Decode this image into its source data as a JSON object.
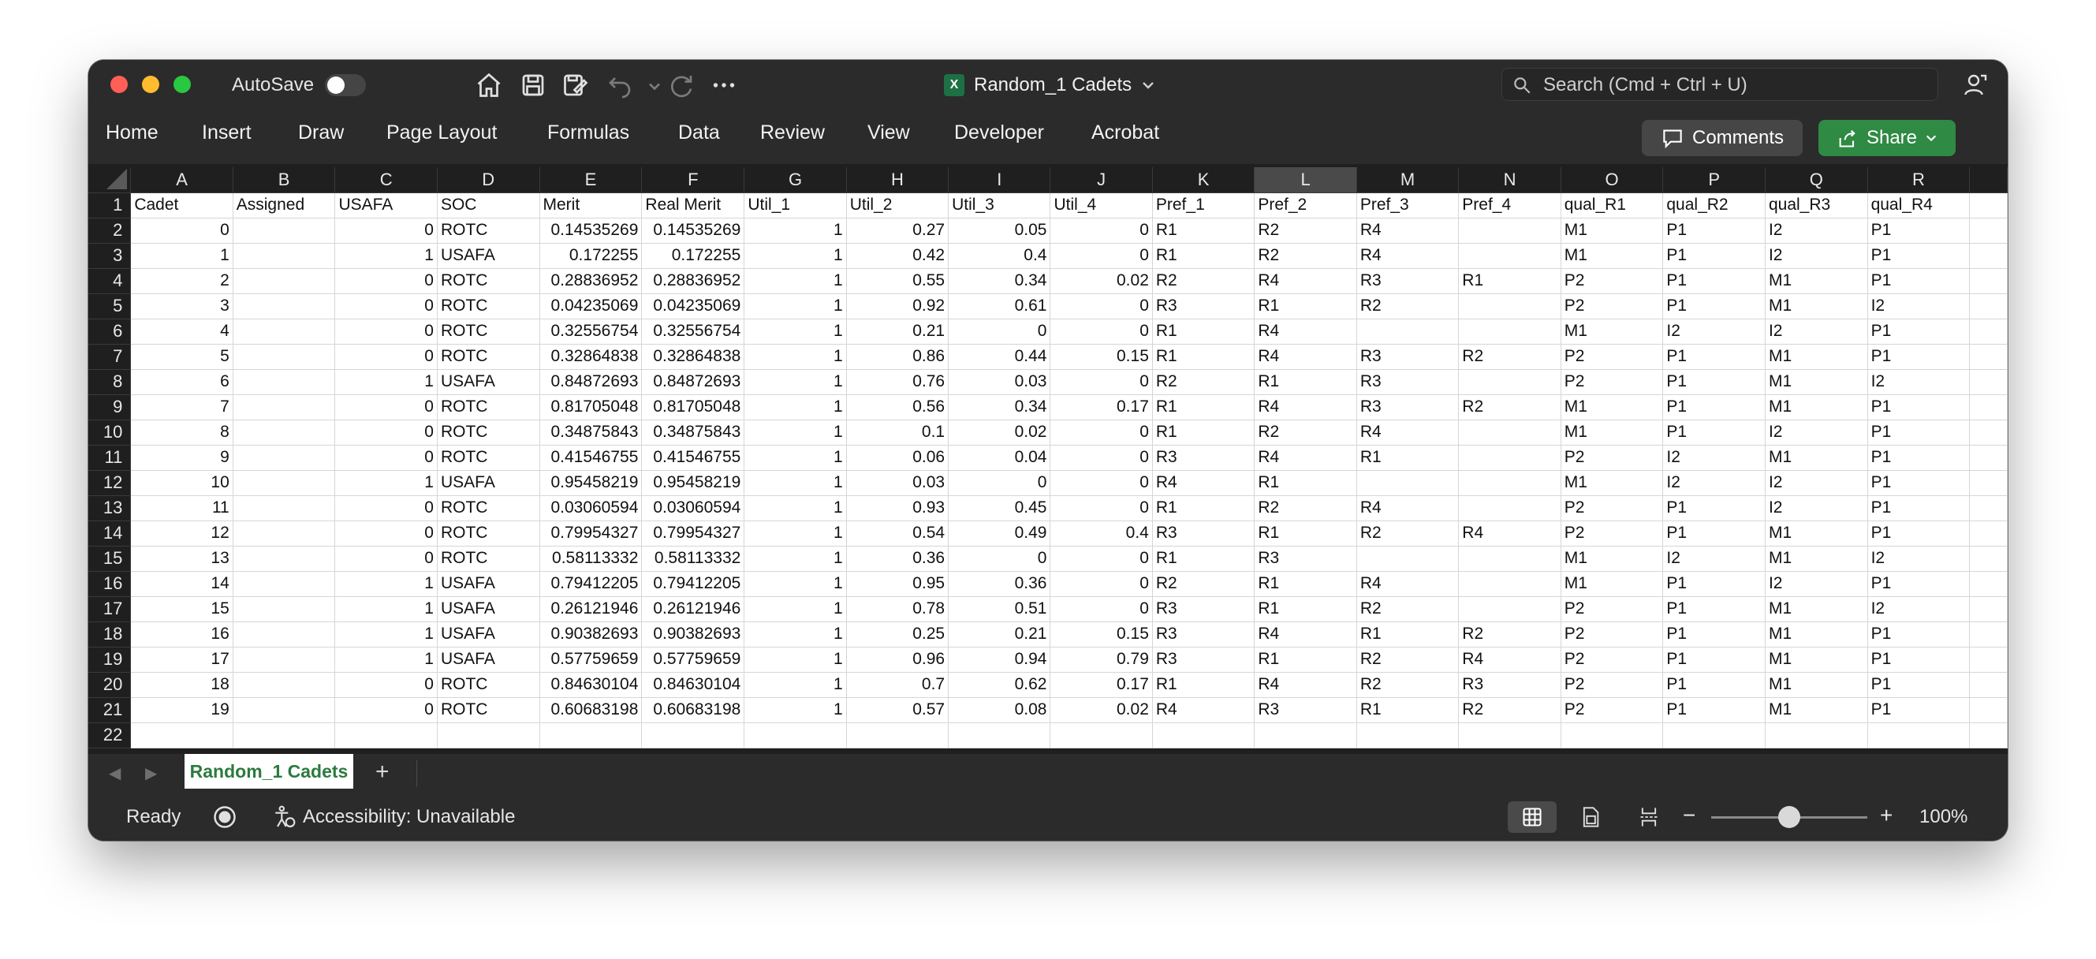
{
  "window": {
    "autosave_label": "AutoSave",
    "title": "Random_1 Cadets",
    "search_placeholder": "Search (Cmd + Ctrl + U)"
  },
  "ribbon": {
    "tabs": [
      "Home",
      "Insert",
      "Draw",
      "Page Layout",
      "Formulas",
      "Data",
      "Review",
      "View",
      "Developer",
      "Acrobat"
    ],
    "comments_label": "Comments",
    "share_label": "Share"
  },
  "sheet": {
    "columns": [
      "A",
      "B",
      "C",
      "D",
      "E",
      "F",
      "G",
      "H",
      "I",
      "J",
      "K",
      "L",
      "M",
      "N",
      "O",
      "P",
      "Q",
      "R"
    ],
    "selected_column": "L",
    "header": [
      "Cadet",
      "Assigned",
      "USAFA",
      "SOC",
      "Merit",
      "Real Merit",
      "Util_1",
      "Util_2",
      "Util_3",
      "Util_4",
      "Pref_1",
      "Pref_2",
      "Pref_3",
      "Pref_4",
      "qual_R1",
      "qual_R2",
      "qual_R3",
      "qual_R4"
    ],
    "rows": [
      [
        "0",
        "",
        "0",
        "ROTC",
        "0.14535269",
        "0.14535269",
        "1",
        "0.27",
        "0.05",
        "0",
        "R1",
        "R2",
        "R4",
        "",
        "M1",
        "P1",
        "I2",
        "P1"
      ],
      [
        "1",
        "",
        "1",
        "USAFA",
        "0.172255",
        "0.172255",
        "1",
        "0.42",
        "0.4",
        "0",
        "R1",
        "R2",
        "R4",
        "",
        "M1",
        "P1",
        "I2",
        "P1"
      ],
      [
        "2",
        "",
        "0",
        "ROTC",
        "0.28836952",
        "0.28836952",
        "1",
        "0.55",
        "0.34",
        "0.02",
        "R2",
        "R4",
        "R3",
        "R1",
        "P2",
        "P1",
        "M1",
        "P1"
      ],
      [
        "3",
        "",
        "0",
        "ROTC",
        "0.04235069",
        "0.04235069",
        "1",
        "0.92",
        "0.61",
        "0",
        "R3",
        "R1",
        "R2",
        "",
        "P2",
        "P1",
        "M1",
        "I2"
      ],
      [
        "4",
        "",
        "0",
        "ROTC",
        "0.32556754",
        "0.32556754",
        "1",
        "0.21",
        "0",
        "0",
        "R1",
        "R4",
        "",
        "",
        "M1",
        "I2",
        "I2",
        "P1"
      ],
      [
        "5",
        "",
        "0",
        "ROTC",
        "0.32864838",
        "0.32864838",
        "1",
        "0.86",
        "0.44",
        "0.15",
        "R1",
        "R4",
        "R3",
        "R2",
        "P2",
        "P1",
        "M1",
        "P1"
      ],
      [
        "6",
        "",
        "1",
        "USAFA",
        "0.84872693",
        "0.84872693",
        "1",
        "0.76",
        "0.03",
        "0",
        "R2",
        "R1",
        "R3",
        "",
        "P2",
        "P1",
        "M1",
        "I2"
      ],
      [
        "7",
        "",
        "0",
        "ROTC",
        "0.81705048",
        "0.81705048",
        "1",
        "0.56",
        "0.34",
        "0.17",
        "R1",
        "R4",
        "R3",
        "R2",
        "M1",
        "P1",
        "M1",
        "P1"
      ],
      [
        "8",
        "",
        "0",
        "ROTC",
        "0.34875843",
        "0.34875843",
        "1",
        "0.1",
        "0.02",
        "0",
        "R1",
        "R2",
        "R4",
        "",
        "M1",
        "P1",
        "I2",
        "P1"
      ],
      [
        "9",
        "",
        "0",
        "ROTC",
        "0.41546755",
        "0.41546755",
        "1",
        "0.06",
        "0.04",
        "0",
        "R3",
        "R4",
        "R1",
        "",
        "P2",
        "I2",
        "M1",
        "P1"
      ],
      [
        "10",
        "",
        "1",
        "USAFA",
        "0.95458219",
        "0.95458219",
        "1",
        "0.03",
        "0",
        "0",
        "R4",
        "R1",
        "",
        "",
        "M1",
        "I2",
        "I2",
        "P1"
      ],
      [
        "11",
        "",
        "0",
        "ROTC",
        "0.03060594",
        "0.03060594",
        "1",
        "0.93",
        "0.45",
        "0",
        "R1",
        "R2",
        "R4",
        "",
        "P2",
        "P1",
        "I2",
        "P1"
      ],
      [
        "12",
        "",
        "0",
        "ROTC",
        "0.79954327",
        "0.79954327",
        "1",
        "0.54",
        "0.49",
        "0.4",
        "R3",
        "R1",
        "R2",
        "R4",
        "P2",
        "P1",
        "M1",
        "P1"
      ],
      [
        "13",
        "",
        "0",
        "ROTC",
        "0.58113332",
        "0.58113332",
        "1",
        "0.36",
        "0",
        "0",
        "R1",
        "R3",
        "",
        "",
        "M1",
        "I2",
        "M1",
        "I2"
      ],
      [
        "14",
        "",
        "1",
        "USAFA",
        "0.79412205",
        "0.79412205",
        "1",
        "0.95",
        "0.36",
        "0",
        "R2",
        "R1",
        "R4",
        "",
        "M1",
        "P1",
        "I2",
        "P1"
      ],
      [
        "15",
        "",
        "1",
        "USAFA",
        "0.26121946",
        "0.26121946",
        "1",
        "0.78",
        "0.51",
        "0",
        "R3",
        "R1",
        "R2",
        "",
        "P2",
        "P1",
        "M1",
        "I2"
      ],
      [
        "16",
        "",
        "1",
        "USAFA",
        "0.90382693",
        "0.90382693",
        "1",
        "0.25",
        "0.21",
        "0.15",
        "R3",
        "R4",
        "R1",
        "R2",
        "P2",
        "P1",
        "M1",
        "P1"
      ],
      [
        "17",
        "",
        "1",
        "USAFA",
        "0.57759659",
        "0.57759659",
        "1",
        "0.96",
        "0.94",
        "0.79",
        "R3",
        "R1",
        "R2",
        "R4",
        "P2",
        "P1",
        "M1",
        "P1"
      ],
      [
        "18",
        "",
        "0",
        "ROTC",
        "0.84630104",
        "0.84630104",
        "1",
        "0.7",
        "0.62",
        "0.17",
        "R1",
        "R4",
        "R2",
        "R3",
        "P2",
        "P1",
        "M1",
        "P1"
      ],
      [
        "19",
        "",
        "0",
        "ROTC",
        "0.60683198",
        "0.60683198",
        "1",
        "0.57",
        "0.08",
        "0.02",
        "R4",
        "R3",
        "R1",
        "R2",
        "P2",
        "P1",
        "M1",
        "P1"
      ]
    ],
    "tab_name": "Random_1 Cadets"
  },
  "status": {
    "ready": "Ready",
    "accessibility": "Accessibility: Unavailable",
    "zoom": "100%",
    "zoom_fraction": 0.5
  }
}
